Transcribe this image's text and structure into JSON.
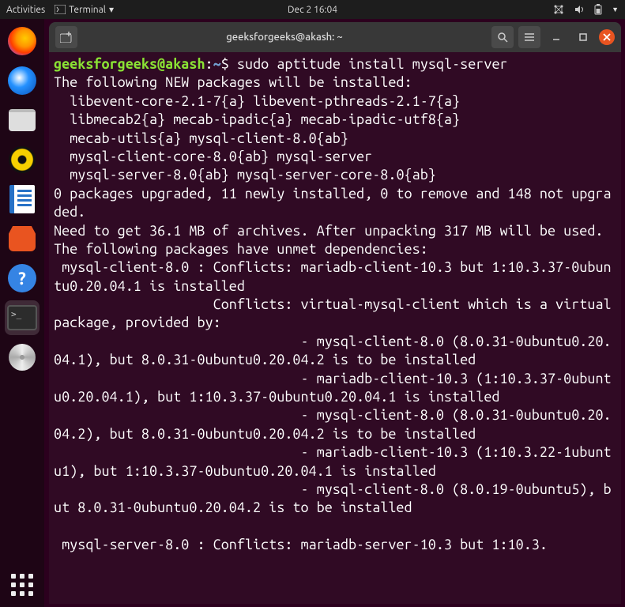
{
  "topbar": {
    "activities": "Activities",
    "app_name": "Terminal",
    "datetime": "Dec 2  16:04"
  },
  "window": {
    "title": "geeksforgeeks@akash: ~"
  },
  "prompt": {
    "user_host": "geeksforgeeks@akash",
    "colon": ":",
    "path": "~",
    "dollar": "$"
  },
  "command": "sudo aptitude install mysql-server",
  "output_lines": [
    "The following NEW packages will be installed:",
    "  libevent-core-2.1-7{a} libevent-pthreads-2.1-7{a} ",
    "  libmecab2{a} mecab-ipadic{a} mecab-ipadic-utf8{a} ",
    "  mecab-utils{a} mysql-client-8.0{ab} ",
    "  mysql-client-core-8.0{ab} mysql-server ",
    "  mysql-server-8.0{ab} mysql-server-core-8.0{ab} ",
    "0 packages upgraded, 11 newly installed, 0 to remove and 148 not upgraded.",
    "Need to get 36.1 MB of archives. After unpacking 317 MB will be used.",
    "The following packages have unmet dependencies:",
    " mysql-client-8.0 : Conflicts: mariadb-client-10.3 but 1:10.3.37-0ubuntu0.20.04.1 is installed",
    "                    Conflicts: virtual-mysql-client which is a virtual package, provided by:",
    "                               - mysql-client-8.0 (8.0.31-0ubuntu0.20.04.1), but 8.0.31-0ubuntu0.20.04.2 is to be installed",
    "                               - mariadb-client-10.3 (1:10.3.37-0ubuntu0.20.04.1), but 1:10.3.37-0ubuntu0.20.04.1 is installed",
    "                               - mysql-client-8.0 (8.0.31-0ubuntu0.20.04.2), but 8.0.31-0ubuntu0.20.04.2 is to be installed",
    "                               - mariadb-client-10.3 (1:10.3.22-1ubuntu1), but 1:10.3.37-0ubuntu0.20.04.1 is installed",
    "                               - mysql-client-8.0 (8.0.19-0ubuntu5), but 8.0.31-0ubuntu0.20.04.2 is to be installed",
    "",
    " mysql-server-8.0 : Conflicts: mariadb-server-10.3 but 1:10.3."
  ]
}
